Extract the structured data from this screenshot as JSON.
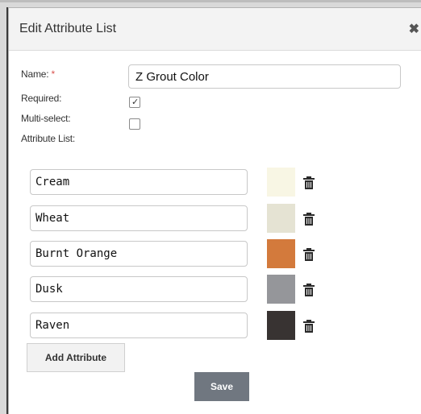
{
  "dialog": {
    "title": "Edit Attribute List",
    "close_icon": "close-icon"
  },
  "form": {
    "name_label": "Name:",
    "required_marker": "*",
    "name_value": "Z Grout Color",
    "required_label": "Required:",
    "required_checked": true,
    "multiselect_label": "Multi-select:",
    "multiselect_checked": false,
    "attribute_list_label": "Attribute List:"
  },
  "attributes": [
    {
      "value": "Cream",
      "color": "#f8f6e4"
    },
    {
      "value": "Wheat",
      "color": "#e5e3d3"
    },
    {
      "value": "Burnt Orange",
      "color": "#d37a3c"
    },
    {
      "value": "Dusk",
      "color": "#95969a"
    },
    {
      "value": "Raven",
      "color": "#383332"
    }
  ],
  "buttons": {
    "add_attribute": "Add Attribute",
    "save": "Save"
  }
}
